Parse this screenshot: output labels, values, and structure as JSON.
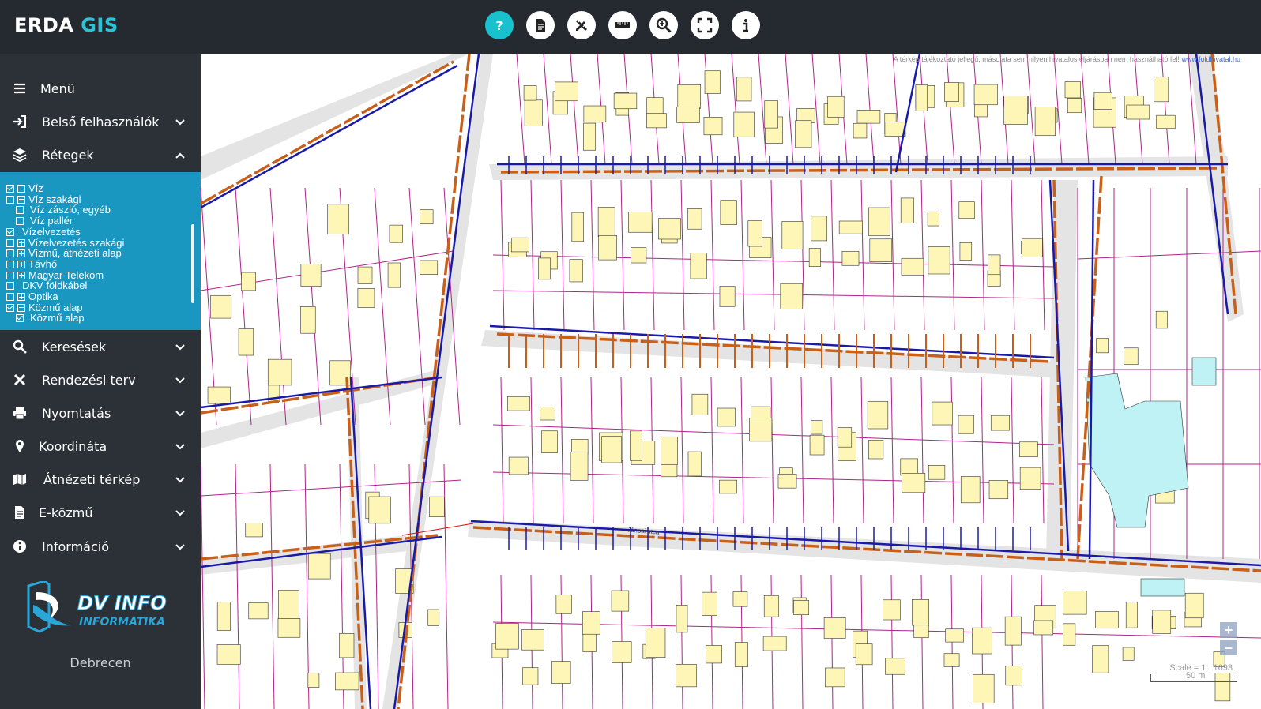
{
  "app": {
    "brand_white": "ERDA",
    "brand_accent": "GIS"
  },
  "toolbar": [
    {
      "name": "help-button",
      "icon": "question-icon",
      "active": true
    },
    {
      "name": "document-button",
      "icon": "document-icon",
      "active": false
    },
    {
      "name": "draw-tools-button",
      "icon": "pencil-ruler-icon",
      "active": false
    },
    {
      "name": "measure-button",
      "icon": "ruler-icon",
      "active": false
    },
    {
      "name": "zoom-button",
      "icon": "zoom-in-icon",
      "active": false
    },
    {
      "name": "fullscreen-button",
      "icon": "fullscreen-icon",
      "active": false
    },
    {
      "name": "info-button",
      "icon": "info-icon",
      "active": false
    }
  ],
  "sidebar": {
    "menu": "Menü",
    "internal_users": "Belső felhasználók",
    "layers_title": "Rétegek",
    "searches": "Keresések",
    "zoning_plan": "Rendezési terv",
    "printing": "Nyomtatás",
    "coordinate": "Koordináta",
    "overview_map": "Átnézeti térkép",
    "e_utility": "E-közmű",
    "information": "Információ"
  },
  "layers": [
    {
      "label": "Víz",
      "checked": true,
      "expander": "minus",
      "level": 0
    },
    {
      "label": "Víz szakági",
      "checked": false,
      "expander": "minus",
      "level": 1
    },
    {
      "label": "Víz zászló, egyéb",
      "checked": false,
      "expander": "none",
      "level": 2
    },
    {
      "label": "Víz pallér",
      "checked": false,
      "expander": "none",
      "level": 2
    },
    {
      "label": "Vízelvezetés",
      "checked": true,
      "expander": "none",
      "level": 0
    },
    {
      "label": "Vízelvezetés szakági",
      "checked": false,
      "expander": "plus",
      "level": 1
    },
    {
      "label": "Vízmű, átnézeti alap",
      "checked": false,
      "expander": "plus",
      "level": 1
    },
    {
      "label": "Távhő",
      "checked": false,
      "expander": "plus",
      "level": 1
    },
    {
      "label": "Magyar Telekom",
      "checked": false,
      "expander": "plus",
      "level": 1
    },
    {
      "label": "DKV földkábel",
      "checked": false,
      "expander": "none",
      "level": 0
    },
    {
      "label": "Optika",
      "checked": false,
      "expander": "plus",
      "level": 1
    },
    {
      "label": "Közmű alap",
      "checked": true,
      "expander": "minus",
      "level": 1
    },
    {
      "label": "Közmű alap",
      "checked": true,
      "expander": "none",
      "level": 2
    }
  ],
  "footer": {
    "logo_line1": "DV INFO",
    "logo_line2": "INFORMATIKA",
    "city": "Debrecen"
  },
  "map": {
    "disclaimer": "A térkép tájékoztató jellegű, másolata semmilyen hivatalos eljárásban nem használható fel!",
    "disclaimer_link": "www.foldhivatal.hu",
    "zoom_in": "+",
    "zoom_out": "–",
    "scale_text": "Scale = 1 : 1693",
    "scale_bar_label": "50 m",
    "street_label": "Jánosi utca",
    "colors": {
      "parcel": "#b0238a",
      "building": "#fdf6b6",
      "water": "#1a1aa8",
      "sewer": "#c8601a",
      "road": "#e4e4e4",
      "public_building": "#bff2f4"
    }
  }
}
